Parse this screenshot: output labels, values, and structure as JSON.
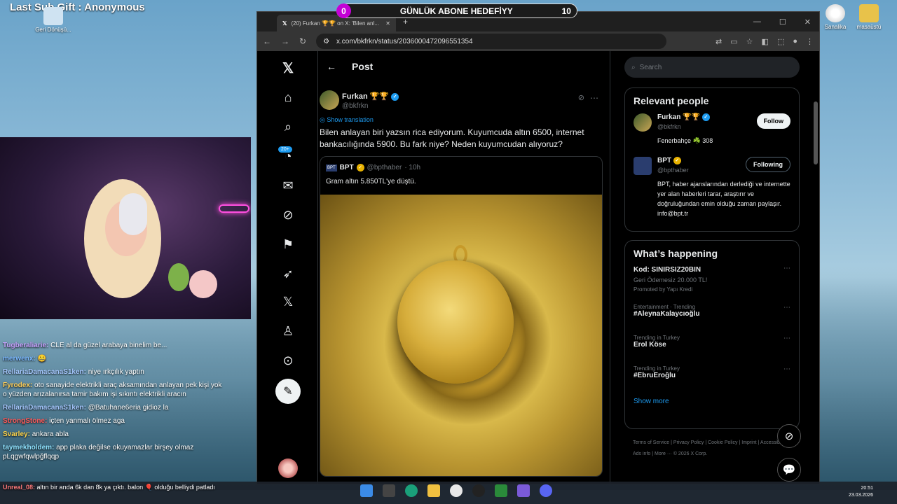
{
  "overlay": {
    "sub_gift": "Last Sub Gift : Anonymous",
    "goal_current": "0",
    "goal_label": "GÜNLÜK ABONE HEDEFİYY",
    "goal_target": "10"
  },
  "desktop": {
    "icons": [
      "Geri Dönüşü...",
      "Sanalika",
      "masaüstü"
    ]
  },
  "chat": [
    {
      "user": "Tugberaliarie:",
      "text": "CLE al da güzel arabaya binelim be...",
      "color": "#c8a2ff"
    },
    {
      "user": "merwenx:",
      "text": "🤐",
      "color": "#7ab8ff"
    },
    {
      "user": "RellariaDamacanaS1ken:",
      "text": "niye ırkçılık yaptın",
      "color": "#a6c8ff"
    },
    {
      "user": "Fyrodex:",
      "text": "oto sanayide elektrikli araç aksamından anlayan pek kişi yok o yüzden arızalanırsa tamir bakım işi sıkıntı elektrikli aracın",
      "color": "#ffcf5a"
    },
    {
      "user": "RellariaDamacanaS1ken:",
      "text": "@Batuhane6eria gidioz la",
      "color": "#a6c8ff"
    },
    {
      "user": "StrongStone:",
      "text": "içten yanmalı ölmez aga",
      "color": "#ff5a5a"
    },
    {
      "user": "Svarley:",
      "text": "ankara abla",
      "color": "#ffd64d"
    },
    {
      "user": "taymekholdem:",
      "text": "app plaka değilse okuyamazlar birşey olmaz pLqgwfqwlpğflqqp",
      "color": "#8fe3ff"
    }
  ],
  "ticker": {
    "user": "Unreal_08:",
    "text": "altın bir anda 6k dan 8k ya çıktı. balon 🎈 olduğu belliydi patladı"
  },
  "browser": {
    "tab_title": "(20) Furkan 🏆🏆 on X: 'Bilen anl...",
    "url": "x.com/bkfrkn/status/2036000472096551354",
    "window_controls": [
      "—",
      "☐",
      "✕"
    ]
  },
  "x": {
    "header_title": "Post",
    "notif_badge": "20+",
    "author_name": "Furkan 🏆🏆",
    "author_handle": "@bkfrkn",
    "show_translation": "Show translation",
    "tweet_text": "Bilen anlayan biri yazsın rica ediyorum. Kuyumcuda altın 6500, internet bankacılığında 5900. Bu fark niye? Neden kuyumcudan alıyoruz?",
    "quote": {
      "name": "BPT",
      "handle": "@bpthaber",
      "time": "· 10h",
      "text": "Gram altın 5.850TL'ye düştü."
    },
    "search_placeholder": "Search",
    "relevant_title": "Relevant people",
    "people": [
      {
        "name": "Furkan 🏆🏆",
        "handle": "@bkfrkn",
        "bio": "Fenerbahçe ☘️ 308",
        "button": "Follow"
      },
      {
        "name": "BPT",
        "handle": "@bpthaber",
        "bio": "BPT, haber ajanslarından derlediği ve internette yer alan haberleri tarar, araştırır ve doğruluğundan emin olduğu zaman paylaşır. info@bpt.tr",
        "button": "Following"
      }
    ],
    "happening_title": "What’s happening",
    "promo": {
      "title": "Kod: SINIRSIZ20BIN",
      "sub": "Geri Ödemesiz 20.000 TL!",
      "promoted": "Promoted by Yapı Kredi"
    },
    "trends": [
      {
        "meta": "Entertainment · Trending",
        "title": "#AleynaKalaycıoğlu"
      },
      {
        "meta": "Trending in Turkey",
        "title": "Erol Köse"
      },
      {
        "meta": "Trending in Turkey",
        "title": "#EbruEroğlu"
      }
    ],
    "show_more": "Show more",
    "footer": "Terms of Service | Privacy Policy | Cookie Policy | Imprint | Accessibility | Ads info | More ··· © 2026 X Corp."
  },
  "taskbar": {
    "time": "20:51",
    "date": "23.03.2026"
  }
}
